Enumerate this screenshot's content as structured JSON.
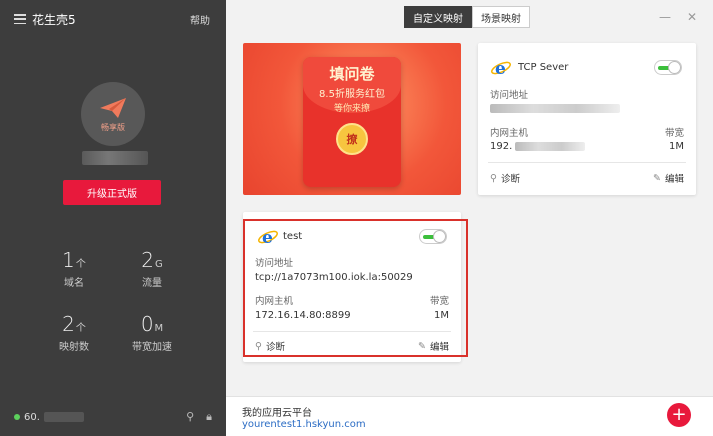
{
  "app": {
    "title": "花生壳5",
    "help_label": "帮助"
  },
  "user": {
    "badge": "畅享版",
    "upgrade_label": "升级正式版"
  },
  "stats": [
    {
      "num": "1",
      "unit": "个",
      "label": "域名"
    },
    {
      "num": "2",
      "unit": "G",
      "label": "流量"
    },
    {
      "num": "2",
      "unit": "个",
      "label": "映射数"
    },
    {
      "num": "0",
      "unit": "M",
      "label": "带宽加速"
    }
  ],
  "footer": {
    "ip_prefix": "60."
  },
  "tabs": [
    {
      "label": "自定义映射",
      "active": true
    },
    {
      "label": "场景映射",
      "active": false
    }
  ],
  "banner": {
    "line1": "填问卷",
    "line2": "8.5折服务红包",
    "line3": "等你来撩",
    "coin": "撩"
  },
  "cards": [
    {
      "name": "TCP Sever",
      "access_label": "访问地址",
      "host_label": "内网主机",
      "bandwidth_label": "带宽",
      "host_prefix": "192.",
      "bandwidth": "1M",
      "diagnose_label": "诊断",
      "edit_label": "编辑",
      "enabled": true
    },
    {
      "name": "test",
      "access_label": "访问地址",
      "access_address": "tcp://1a7073m100.iok.la:50029",
      "host_label": "内网主机",
      "host": "172.16.14.80:8899",
      "bandwidth_label": "带宽",
      "bandwidth": "1M",
      "diagnose_label": "诊断",
      "edit_label": "编辑",
      "enabled": true
    }
  ],
  "bottom": {
    "platform_label": "我的应用云平台",
    "platform_url": "yourentest1.hskyun.com"
  },
  "colors": {
    "accent_red": "#e8193c",
    "toggle_green": "#3cbf3c",
    "link_blue": "#2b6cc4"
  }
}
